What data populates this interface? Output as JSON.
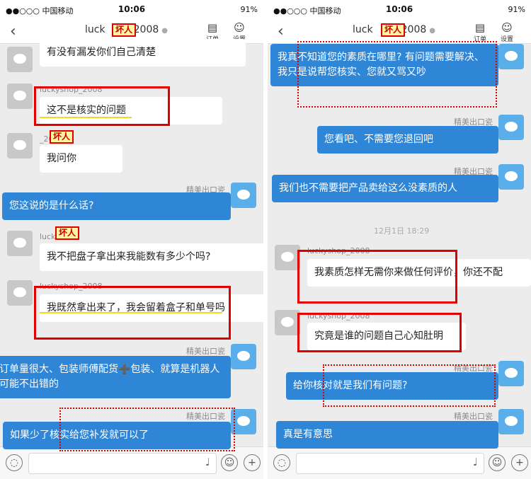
{
  "status_bar": {
    "carrier": "●●○○○ 中国移动",
    "time": "10:06",
    "battery": "91%"
  },
  "nav": {
    "back": "‹",
    "title_left": "luck",
    "title_right": "2008",
    "order_label": "订单",
    "settings_label": "设置",
    "order_icon": "document-icon",
    "settings_icon": "person-icon"
  },
  "tag_text": "坏人",
  "left_panel": {
    "messages": [
      {
        "side": "left",
        "sender": "",
        "text": "有没有漏发你们自己清楚"
      },
      {
        "side": "left",
        "sender": "luckyshop_2008",
        "text": "这不是核实的问题"
      },
      {
        "side": "left",
        "sender": "_2008",
        "text": "我问你"
      },
      {
        "side": "right",
        "sender": "精美出口瓷",
        "text": "您这说的是什么话?"
      },
      {
        "side": "left",
        "sender": "luck",
        "text": "我不把盘子拿出来我能数有多少个吗?"
      },
      {
        "side": "left",
        "sender": "luckyshop_2008",
        "text": "我既然拿出来了，我会留着盒子和单号吗"
      },
      {
        "side": "right",
        "sender": "精美出口瓷",
        "text": "每天订单量很大、包装师傅配货➕包装、就算是机器人也不可能不出错的"
      },
      {
        "side": "right",
        "sender": "精美出口瓷",
        "text": "如果少了核实给您补发就可以了"
      }
    ]
  },
  "right_panel": {
    "messages": [
      {
        "side": "right",
        "sender": "",
        "text": "我真不知道您的素质在哪里? 有问题需要解决、我只是说帮您核实、您就又骂又吵"
      },
      {
        "side": "right",
        "sender": "精美出口瓷",
        "text": "您看吧、不需要您退回吧"
      },
      {
        "side": "right",
        "sender": "精美出口瓷",
        "text": "我们也不需要把产品卖给这么没素质的人"
      },
      {
        "side": "left",
        "sender": "luckyshop_2008",
        "text": "我素质怎样无需你来做任何评价，你还不配"
      },
      {
        "side": "left",
        "sender": "luckyshop_2008",
        "text": "究竟是谁的问题自己心知肚明"
      },
      {
        "side": "right",
        "sender": "精美出口瓷",
        "text": "给你核对就是我们有问题?"
      },
      {
        "side": "right",
        "sender": "精美出口瓷",
        "text": "真是有意思"
      }
    ],
    "timestamp": "12月1日 18:29"
  },
  "input_bar": {
    "voice_icon": "speech-bubble-icon",
    "mic_icon": "microphone-icon",
    "emoji_icon": "smiley-icon",
    "plus_icon": "plus-icon"
  }
}
